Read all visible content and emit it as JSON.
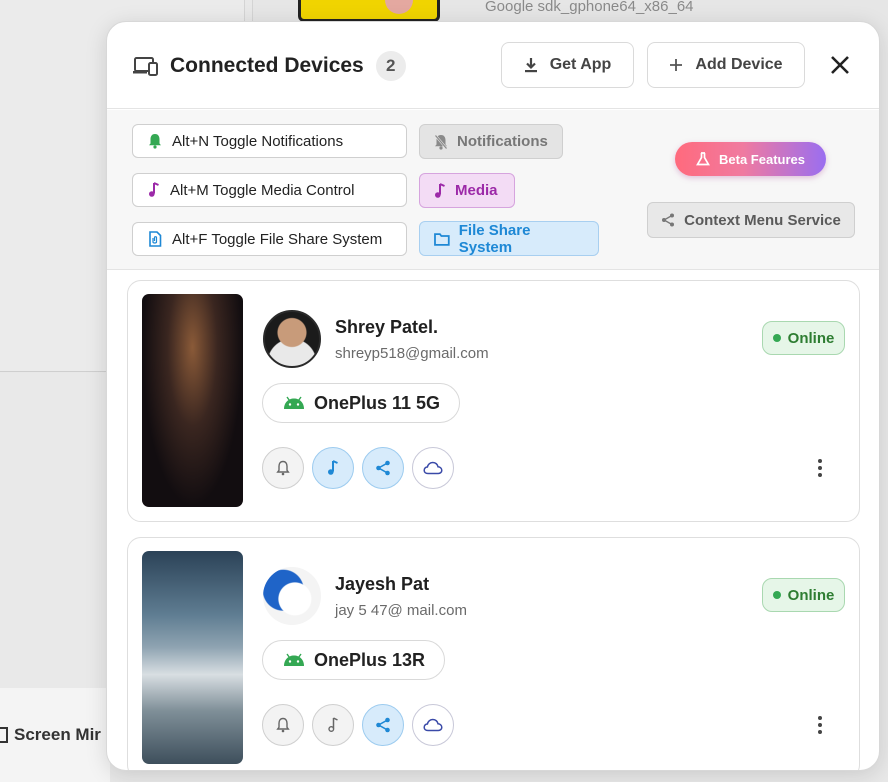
{
  "background": {
    "device_label": "Google sdk_gphone64_x86_64",
    "screen_mirror_label": "Screen Mir"
  },
  "header": {
    "title": "Connected Devices",
    "count": "2",
    "get_app_label": "Get App",
    "add_device_label": "Add Device"
  },
  "shortcuts": [
    {
      "label": "Alt+N Toggle Notifications",
      "icon": "bell-icon",
      "color": "#34a853"
    },
    {
      "label": "Alt+M Toggle Media Control",
      "icon": "music-note-icon",
      "color": "#9c2aa8"
    },
    {
      "label": "Alt+F Toggle File Share System",
      "icon": "file-icon",
      "color": "#1e88d5"
    }
  ],
  "features": {
    "notifications": "Notifications",
    "media": "Media",
    "file_share": "File Share System",
    "beta": "Beta Features",
    "context_menu": "Context Menu Service"
  },
  "devices": [
    {
      "name": "Shrey Patel.",
      "email": "shreyp518@gmail.com",
      "model": "OnePlus 11 5G",
      "status": "Online",
      "actions": {
        "notifications": false,
        "media": true,
        "file_share": true,
        "cloud": true
      }
    },
    {
      "name": "Jayesh Pat",
      "email": "jay 5 47@ mail.com",
      "model": "OnePlus 13R",
      "status": "Online",
      "actions": {
        "notifications": false,
        "media": false,
        "file_share": true,
        "cloud": true
      }
    }
  ],
  "colors": {
    "accent_blue": "#1e88d5",
    "media_purple": "#9c2aa8",
    "online_green": "#2e7d32",
    "android_green": "#34a853"
  }
}
